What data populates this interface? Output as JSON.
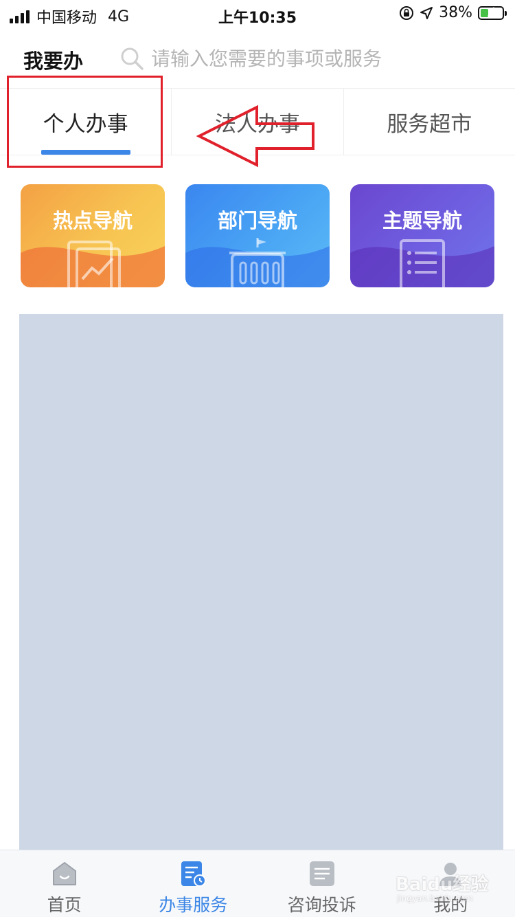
{
  "status_bar": {
    "carrier": "中国移动",
    "network": "4G",
    "time": "上午10:35",
    "battery_percent": "38%",
    "battery_level": 0.38,
    "icons": [
      "signal-icon",
      "orientation-lock-icon",
      "location-icon",
      "battery-charging-icon"
    ]
  },
  "header": {
    "title": "我要办",
    "search_placeholder": "请输入您需要的事项或服务"
  },
  "tabs": [
    {
      "label": "个人办事",
      "active": true
    },
    {
      "label": "法人办事",
      "active": false
    },
    {
      "label": "服务超市",
      "active": false
    }
  ],
  "cards": [
    {
      "label": "热点导航",
      "icon": "trend-chart-icon"
    },
    {
      "label": "部门导航",
      "icon": "government-building-icon"
    },
    {
      "label": "主题导航",
      "icon": "list-document-icon"
    }
  ],
  "tabbar": [
    {
      "label": "首页",
      "icon": "home-icon",
      "active": false
    },
    {
      "label": "办事服务",
      "icon": "service-document-icon",
      "active": true
    },
    {
      "label": "咨询投诉",
      "icon": "consult-complaint-icon",
      "active": false
    },
    {
      "label": "我的",
      "icon": "user-icon",
      "active": false
    }
  ],
  "annotation": {
    "color": "#e0202a"
  },
  "colors": {
    "accent": "#3b86e6",
    "placeholder_bg": "#cdd7e5"
  },
  "watermark": {
    "text": "Baidu经验",
    "sub": "jingyan.baidu.com"
  }
}
